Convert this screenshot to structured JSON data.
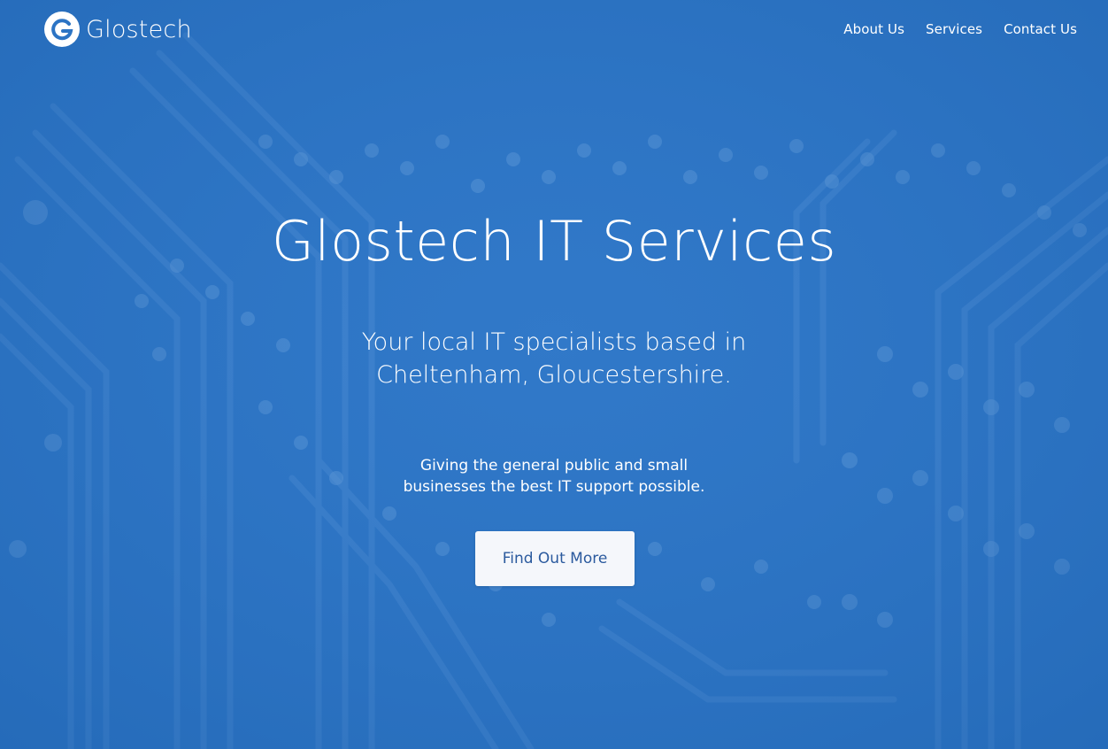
{
  "brand": {
    "name": "Glostech",
    "logo_icon": "g-circle-logo-icon"
  },
  "nav": {
    "items": [
      {
        "label": "About Us"
      },
      {
        "label": "Services"
      },
      {
        "label": "Contact Us"
      }
    ]
  },
  "hero": {
    "title": "Glostech IT Services",
    "tagline": "Your local IT specialists based in Cheltenham, Gloucestershire.",
    "subtext": "Giving the general public and small businesses the best IT support possible.",
    "cta_label": "Find Out More",
    "background": "circuit-board-photo",
    "overlay_color": "#2c74c4"
  },
  "colors": {
    "primary": "#2c74c4",
    "button_bg": "#f5f7fb",
    "button_text": "#2b5a9e",
    "text": "#ffffff"
  }
}
